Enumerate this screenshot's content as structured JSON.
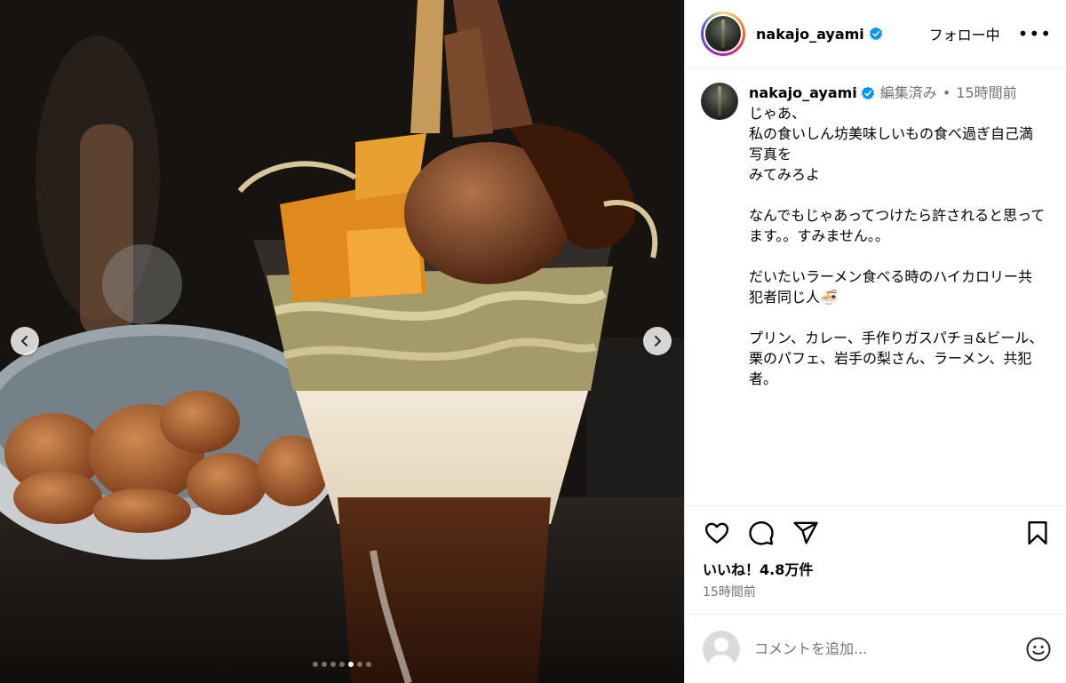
{
  "colors": {
    "accent_verified": "#0095f6",
    "muted": "#737373",
    "border": "#dbdbdb"
  },
  "media": {
    "description_icons": {
      "prev": "chevron-left-icon",
      "next": "chevron-right-icon"
    },
    "carousel": {
      "count": 7,
      "active_index": 4
    }
  },
  "header": {
    "username": "nakajo_ayami",
    "follow_label": "フォロー中",
    "more_label": "•••"
  },
  "caption": {
    "username": "nakajo_ayami",
    "edited": "編集済み",
    "separator": "•",
    "time": "15時間前",
    "text": "じゃあ、\n私の食いしん坊美味しいもの食べ過ぎ自己満写真を\nみてみろよ\n\nなんでもじゃあってつけたら許されると思ってます。。すみません。。\n\nだいたいラーメン食べる時のハイカロリー共犯者同じ人🍜\n\nプリン、カレー、手作りガスパチョ&ビール、栗のパフェ、岩手の梨さん、ラーメン、共犯者。"
  },
  "actions": {
    "icons": [
      "heart-icon",
      "comment-icon",
      "share-icon",
      "bookmark-icon"
    ]
  },
  "likes_label": "いいね！4.8万件",
  "post_time": "15時間前",
  "comment": {
    "placeholder": "コメントを追加..."
  }
}
